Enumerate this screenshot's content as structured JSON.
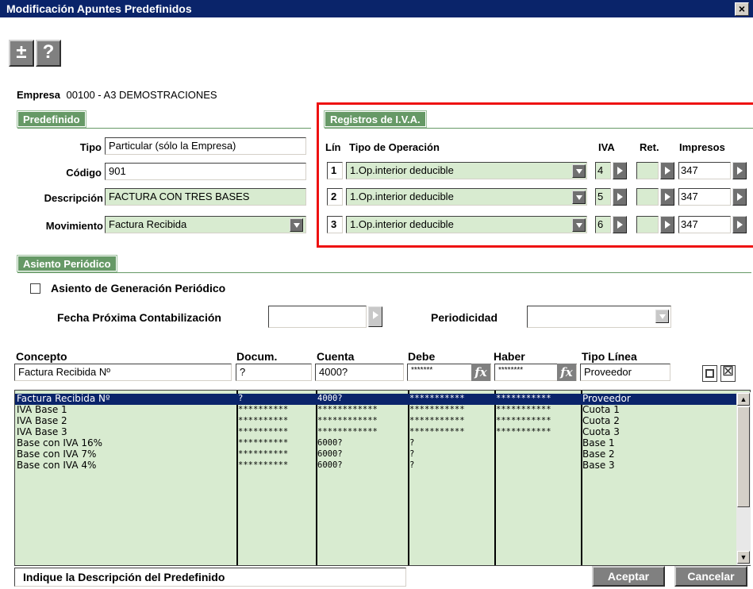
{
  "window": {
    "title": "Modificación Apuntes Predefinidos",
    "close": "×"
  },
  "toolbar": {
    "plusminus": "±",
    "help": "?"
  },
  "empresa": {
    "label": "Empresa",
    "value": "00100  -  A3 DEMOSTRACIONES"
  },
  "predefinido": {
    "tab": "Predefinido",
    "tipo_label": "Tipo",
    "tipo_value": "Particular (sólo la Empresa)",
    "codigo_label": "Código",
    "codigo_value": "901",
    "descripcion_label": "Descripción",
    "descripcion_value": "FACTURA CON TRES BASES",
    "movimiento_label": "Movimiento",
    "movimiento_value": "Factura Recibida"
  },
  "iva": {
    "tab": "Registros de I.V.A.",
    "headers": {
      "lin": "Lín",
      "tipo": "Tipo de Operación",
      "iva": "IVA",
      "ret": "Ret.",
      "impresos": "Impresos"
    },
    "rows": [
      {
        "lin": "1",
        "tipo": "1.Op.interior deducible",
        "iva": "4",
        "ret": "",
        "impresos": "347"
      },
      {
        "lin": "2",
        "tipo": "1.Op.interior deducible",
        "iva": "5",
        "ret": "",
        "impresos": "347"
      },
      {
        "lin": "3",
        "tipo": "1.Op.interior deducible",
        "iva": "6",
        "ret": "",
        "impresos": "347"
      }
    ]
  },
  "periodico": {
    "tab": "Asiento Periódico",
    "checkbox_label": "Asiento de Generación Periódico",
    "fecha_label": "Fecha Próxima Contabilización",
    "fecha_value": "",
    "periodicidad_label": "Periodicidad",
    "periodicidad_value": ""
  },
  "lines": {
    "headers": {
      "concepto": "Concepto",
      "docum": "Docum.",
      "cuenta": "Cuenta",
      "debe": "Debe",
      "haber": "Haber",
      "tipo": "Tipo Línea"
    },
    "edit": {
      "concepto": "Factura Recibida Nº",
      "docum": "?",
      "cuenta": "4000?",
      "debe": "*******",
      "haber": "********",
      "tipo": "Proveedor"
    },
    "fx": "fx",
    "rows": [
      {
        "concepto": "Factura Recibida Nº",
        "docum": "?",
        "cuenta": "4000?",
        "debe": "***********",
        "haber": "***********",
        "tipo": "Proveedor"
      },
      {
        "concepto": "IVA Base 1",
        "docum": "**********",
        "cuenta": "************",
        "debe": "***********",
        "haber": "***********",
        "tipo": "Cuota 1"
      },
      {
        "concepto": "IVA Base 2",
        "docum": "**********",
        "cuenta": "************",
        "debe": "***********",
        "haber": "***********",
        "tipo": "Cuota 2"
      },
      {
        "concepto": "IVA Base 3",
        "docum": "**********",
        "cuenta": "************",
        "debe": "***********",
        "haber": "***********",
        "tipo": "Cuota 3"
      },
      {
        "concepto": "Base con IVA 16%",
        "docum": "**********",
        "cuenta": "6000?",
        "debe": "?",
        "haber": "",
        "tipo": "Base 1"
      },
      {
        "concepto": "Base con IVA 7%",
        "docum": "**********",
        "cuenta": "6000?",
        "debe": "?",
        "haber": "",
        "tipo": "Base 2"
      },
      {
        "concepto": "Base con IVA 4%",
        "docum": "**********",
        "cuenta": "6000?",
        "debe": "?",
        "haber": "",
        "tipo": "Base 3"
      }
    ]
  },
  "status": {
    "hint": "Indique la Descripción del Predefinido"
  },
  "buttons": {
    "aceptar": "Aceptar",
    "cancelar": "Cancelar"
  },
  "colors": {
    "titlebar": "#0a246a",
    "tab_green": "#669966",
    "field_green": "#d8ebd0",
    "selection": "#0a246a",
    "highlight_border": "#ee1111"
  }
}
